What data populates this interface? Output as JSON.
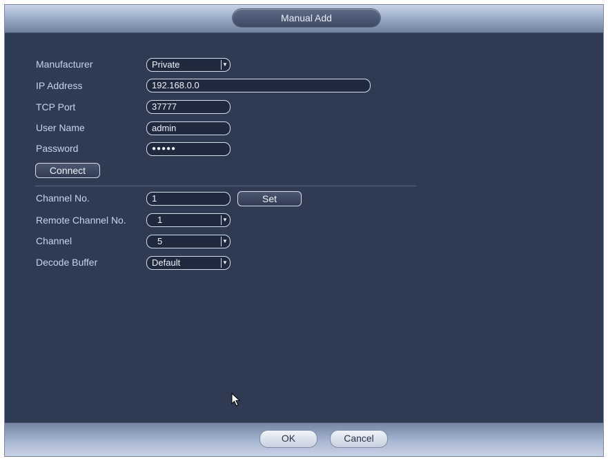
{
  "dialog": {
    "title": "Manual Add"
  },
  "form": {
    "manufacturer": {
      "label": "Manufacturer",
      "value": "Private"
    },
    "ip_address": {
      "label": "IP Address",
      "value": "192.168.0.0"
    },
    "tcp_port": {
      "label": "TCP Port",
      "value": "37777"
    },
    "user_name": {
      "label": "User Name",
      "value": "admin"
    },
    "password": {
      "label": "Password",
      "value": "●●●●●"
    },
    "connect_label": "Connect",
    "channel_no": {
      "label": "Channel No.",
      "value": "1"
    },
    "set_label": "Set",
    "remote_channel_no": {
      "label": "Remote Channel No.",
      "value": "1"
    },
    "channel": {
      "label": "Channel",
      "value": "5"
    },
    "decode_buffer": {
      "label": "Decode Buffer",
      "value": "Default"
    }
  },
  "footer": {
    "ok_label": "OK",
    "cancel_label": "Cancel"
  },
  "icons": {
    "dropdown": "chevron-down-icon",
    "cursor": "mouse-pointer-icon"
  },
  "colors": {
    "panel": "#2f3b52",
    "label": "#c8d4ea",
    "field_border": "#d7deec"
  }
}
